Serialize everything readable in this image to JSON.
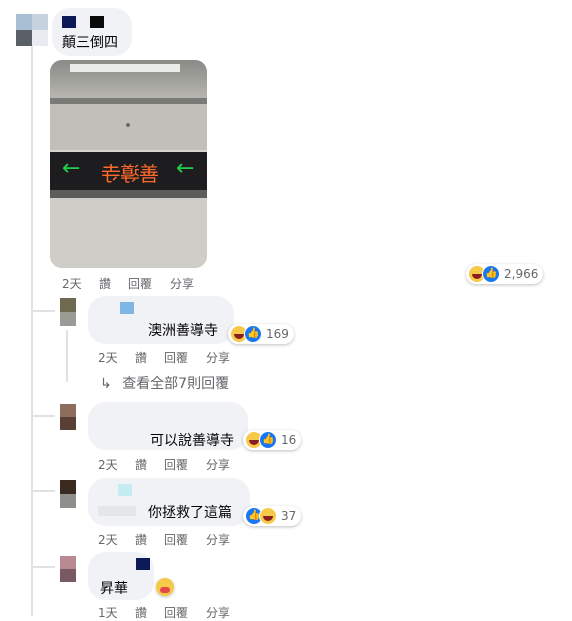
{
  "comments": [
    {
      "author": "",
      "text": "顛三倒四",
      "actions": [
        "2天",
        "讚",
        "回覆",
        "分享"
      ],
      "reaction_count": "2,966"
    }
  ],
  "replies": [
    {
      "text": "澳洲善導寺",
      "actions": [
        "2天",
        "讚",
        "回覆",
        "分享"
      ],
      "reaction_count": "169"
    },
    {
      "text": "可以說善導寺",
      "actions": [
        "2天",
        "讚",
        "回覆",
        "分享"
      ],
      "reaction_count": "16"
    },
    {
      "text": "你拯救了這篇",
      "actions": [
        "2天",
        "讚",
        "回覆",
        "分享"
      ],
      "reaction_count": "37"
    },
    {
      "text": "昇華",
      "actions": [
        "1天",
        "讚",
        "回覆",
        "分享"
      ],
      "reaction_count": ""
    }
  ],
  "view_replies": {
    "arrow": "↳",
    "label": "查看全部7則回覆"
  },
  "photo": {
    "sign_text": "善導寺",
    "arrow_left": "←",
    "arrow_right": "←"
  },
  "icons": {
    "reaction_haha": "haha-icon",
    "reaction_like": "like-icon",
    "reaction_care": "care-icon"
  },
  "colors": {
    "bubble": "#f0f2f5",
    "meta": "#65676b",
    "like": "#1877f2",
    "haha": "#f7c948",
    "sign": "#ff6a2a",
    "sign_arrow": "#1fd14a"
  }
}
